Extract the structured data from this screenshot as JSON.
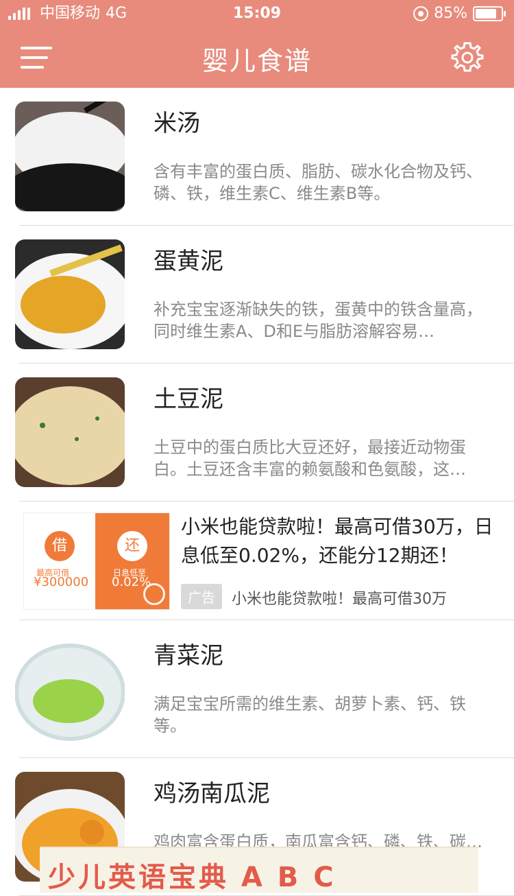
{
  "status": {
    "carrier": "中国移动",
    "network": "4G",
    "time": "15:09",
    "battery": "85%"
  },
  "nav": {
    "title": "婴儿食谱"
  },
  "recipes": [
    {
      "name": "米汤",
      "desc": "含有丰富的蛋白质、脂肪、碳水化合物及钙、磷、铁，维生素C、维生素B等。"
    },
    {
      "name": "蛋黄泥",
      "desc": "补充宝宝逐渐缺失的铁，蛋黄中的铁含量高，同时维生素A、D和E与脂肪溶解容易…"
    },
    {
      "name": "土豆泥",
      "desc": "土豆中的蛋白质比大豆还好，最接近动物蛋白。土豆还含丰富的赖氨酸和色氨酸，这…"
    }
  ],
  "ad": {
    "title": "小米也能贷款啦！最高可借30万，日息低至0.02%，还能分12期还！",
    "badge": "广告",
    "subtitle": "小米也能贷款啦！最高可借30万",
    "image": {
      "left_bubble": "借",
      "right_bubble": "还",
      "left_label": "最高可借",
      "left_amount": "¥300000",
      "right_label": "日息低至",
      "right_amount": "0.02%"
    }
  },
  "recipes2": [
    {
      "name": "青菜泥",
      "desc": "满足宝宝所需的维生素、胡萝卜素、钙、铁等。"
    },
    {
      "name": "鸡汤南瓜泥",
      "desc": "鸡肉富含蛋白质，南瓜富含钙、磷、铁、碳…"
    }
  ],
  "banner": {
    "text": "少儿英语宝典 A B C"
  },
  "colors": {
    "header": "#E88B7C",
    "ad_orange": "#F07B39"
  }
}
